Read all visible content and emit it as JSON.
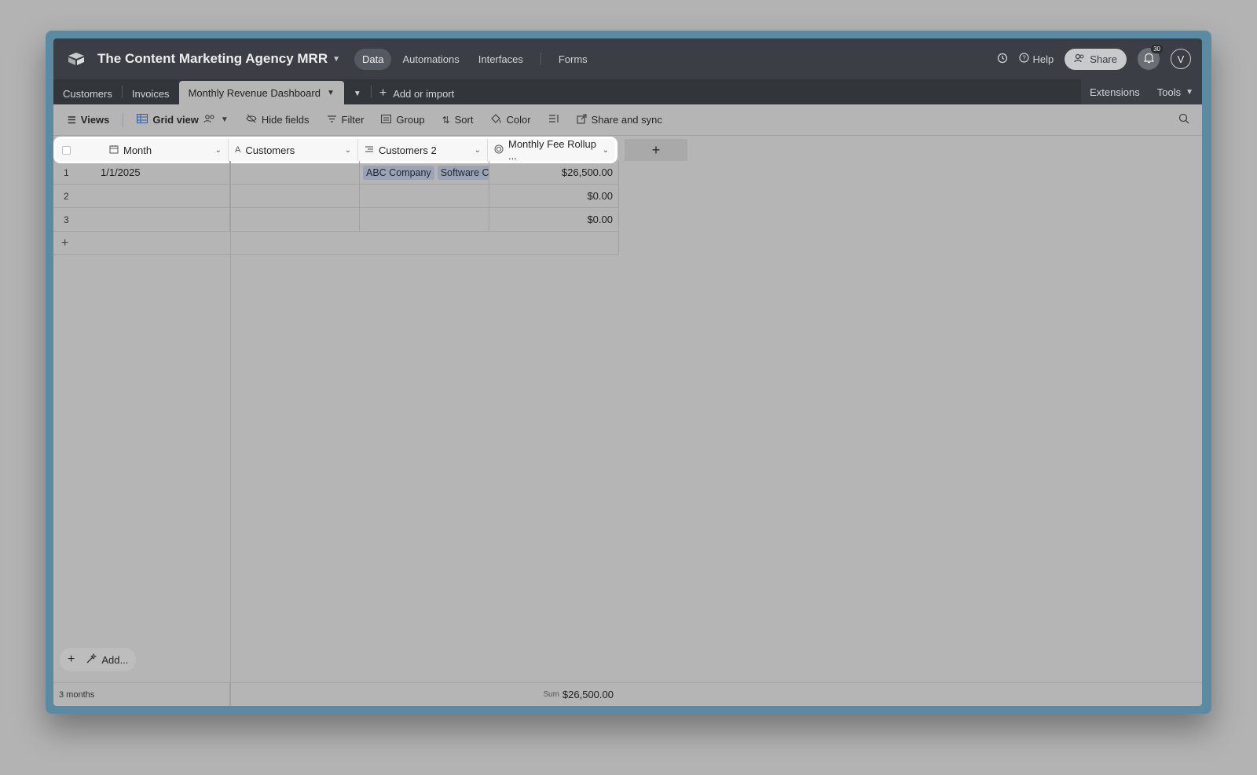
{
  "topbar": {
    "base_title": "The Content Marketing Agency MRR",
    "nav": [
      "Data",
      "Automations",
      "Interfaces",
      "Forms"
    ],
    "help_label": "Help",
    "share_label": "Share",
    "notification_count": "30",
    "avatar_initial": "V"
  },
  "tabs": {
    "items": [
      "Customers",
      "Invoices",
      "Monthly Revenue Dashboard"
    ],
    "add_import_label": "Add or import",
    "extensions_label": "Extensions",
    "tools_label": "Tools"
  },
  "toolbar": {
    "views_label": "Views",
    "grid_view_label": "Grid view",
    "hide_fields_label": "Hide fields",
    "filter_label": "Filter",
    "group_label": "Group",
    "sort_label": "Sort",
    "color_label": "Color",
    "share_sync_label": "Share and sync"
  },
  "grid": {
    "columns": [
      "Month",
      "Customers",
      "Customers 2",
      "Monthly Fee Rollup ..."
    ],
    "rows": [
      {
        "num": "1",
        "month": "1/1/2025",
        "customers": "",
        "customers2": [
          "ABC Company",
          "Software Co"
        ],
        "fee": "$26,500.00"
      },
      {
        "num": "2",
        "month": "",
        "customers": "",
        "customers2": [],
        "fee": "$0.00"
      },
      {
        "num": "3",
        "month": "",
        "customers": "",
        "customers2": [],
        "fee": "$0.00"
      }
    ],
    "add_label": "Add...",
    "record_count": "3 months",
    "sum_label": "Sum",
    "sum_value": "$26,500.00"
  }
}
